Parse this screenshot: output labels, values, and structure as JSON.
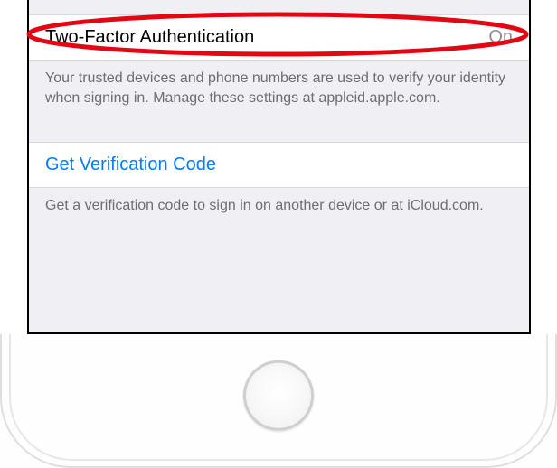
{
  "twofa": {
    "label": "Two-Factor Authentication",
    "value": "On",
    "footer": "Your trusted devices and phone numbers are used to verify your identity when signing in. Manage these settings at appleid.apple.com."
  },
  "verification": {
    "link": "Get Verification Code",
    "footer": "Get a verification code to sign in on another device or at iCloud.com."
  },
  "annotation": {
    "color": "#e30613"
  }
}
